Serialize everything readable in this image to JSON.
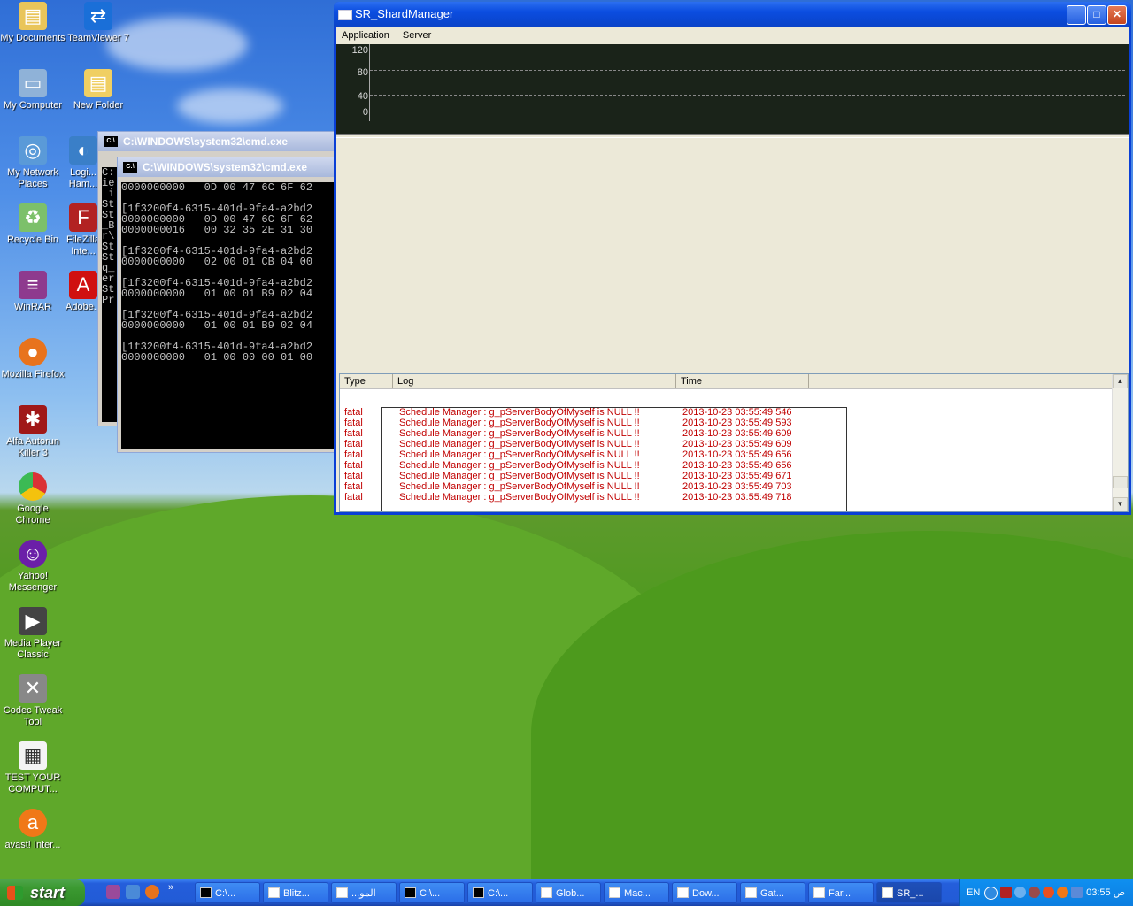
{
  "desktop_icons": [
    {
      "label": "My Documents"
    },
    {
      "label": "TeamViewer 7"
    },
    {
      "label": "My Computer"
    },
    {
      "label": "New Folder"
    },
    {
      "label": "My Network Places"
    },
    {
      "label": "Logi... Ham..."
    },
    {
      "label": "Recycle Bin"
    },
    {
      "label": "FileZilla Inte..."
    },
    {
      "label": "WinRAR"
    },
    {
      "label": "Adobe..."
    },
    {
      "label": "Mozilla Firefox"
    },
    {
      "label": "Alfa Autorun Killer 3"
    },
    {
      "label": "Google Chrome"
    },
    {
      "label": "Yahoo! Messenger"
    },
    {
      "label": "Media Player Classic"
    },
    {
      "label": "Codec Tweak Tool"
    },
    {
      "label": "TEST YOUR COMPUT..."
    },
    {
      "label": "avast! Inter..."
    }
  ],
  "cmd_back": {
    "title": "C:\\WINDOWS\\system32\\cmd.exe",
    "lines": [
      "C:",
      "ie",
      " i",
      "St",
      "St",
      "_B",
      "r\\",
      "St",
      "St",
      "q_",
      "er",
      "St",
      "Pr"
    ]
  },
  "cmd_front": {
    "title": "C:\\WINDOWS\\system32\\cmd.exe",
    "lines": [
      "0000000000   0D 00 47 6C 6F 62",
      "",
      "[1f3200f4-6315-401d-9fa4-a2bd2",
      "0000000000   0D 00 47 6C 6F 62",
      "0000000016   00 32 35 2E 31 30",
      "",
      "[1f3200f4-6315-401d-9fa4-a2bd2",
      "0000000000   02 00 01 CB 04 00",
      "",
      "[1f3200f4-6315-401d-9fa4-a2bd2",
      "0000000000   01 00 01 B9 02 04",
      "",
      "[1f3200f4-6315-401d-9fa4-a2bd2",
      "0000000000   01 00 01 B9 02 04",
      "",
      "[1f3200f4-6315-401d-9fa4-a2bd2",
      "0000000000   01 00 00 00 01 00"
    ]
  },
  "app": {
    "title": "SR_ShardManager",
    "menu": [
      "Application",
      "Server"
    ],
    "graph_ticks": [
      "120",
      "80",
      "40",
      "0"
    ],
    "columns": [
      "Type",
      "Log",
      "Time"
    ],
    "log_rows": [
      {
        "type": "fatal",
        "log": "Schedule Manager : g_pServerBodyOfMyself is NULL !!",
        "time": "2013-10-23 03:55:49 546"
      },
      {
        "type": "fatal",
        "log": "Schedule Manager : g_pServerBodyOfMyself is NULL !!",
        "time": "2013-10-23 03:55:49 593"
      },
      {
        "type": "fatal",
        "log": "Schedule Manager : g_pServerBodyOfMyself is NULL !!",
        "time": "2013-10-23 03:55:49 609"
      },
      {
        "type": "fatal",
        "log": "Schedule Manager : g_pServerBodyOfMyself is NULL !!",
        "time": "2013-10-23 03:55:49 609"
      },
      {
        "type": "fatal",
        "log": "Schedule Manager : g_pServerBodyOfMyself is NULL !!",
        "time": "2013-10-23 03:55:49 656"
      },
      {
        "type": "fatal",
        "log": "Schedule Manager : g_pServerBodyOfMyself is NULL !!",
        "time": "2013-10-23 03:55:49 656"
      },
      {
        "type": "fatal",
        "log": "Schedule Manager : g_pServerBodyOfMyself is NULL !!",
        "time": "2013-10-23 03:55:49 671"
      },
      {
        "type": "fatal",
        "log": "Schedule Manager : g_pServerBodyOfMyself is NULL !!",
        "time": "2013-10-23 03:55:49 703"
      },
      {
        "type": "fatal",
        "log": "Schedule Manager : g_pServerBodyOfMyself is NULL !!",
        "time": "2013-10-23 03:55:49 718"
      }
    ]
  },
  "taskbar": {
    "start_label": "start",
    "buttons": [
      "C:\\...",
      "Blitz...",
      "...المو",
      "C:\\...",
      "C:\\...",
      "Glob...",
      "Mac...",
      "Dow...",
      "Gat...",
      "Far...",
      "SR_..."
    ],
    "active_index": 10,
    "language": "EN",
    "clock": "03:55 ص"
  },
  "colors": {
    "log_text": "#c00000",
    "graph_bg": "#1a2319",
    "xp_blue": "#245edb"
  }
}
